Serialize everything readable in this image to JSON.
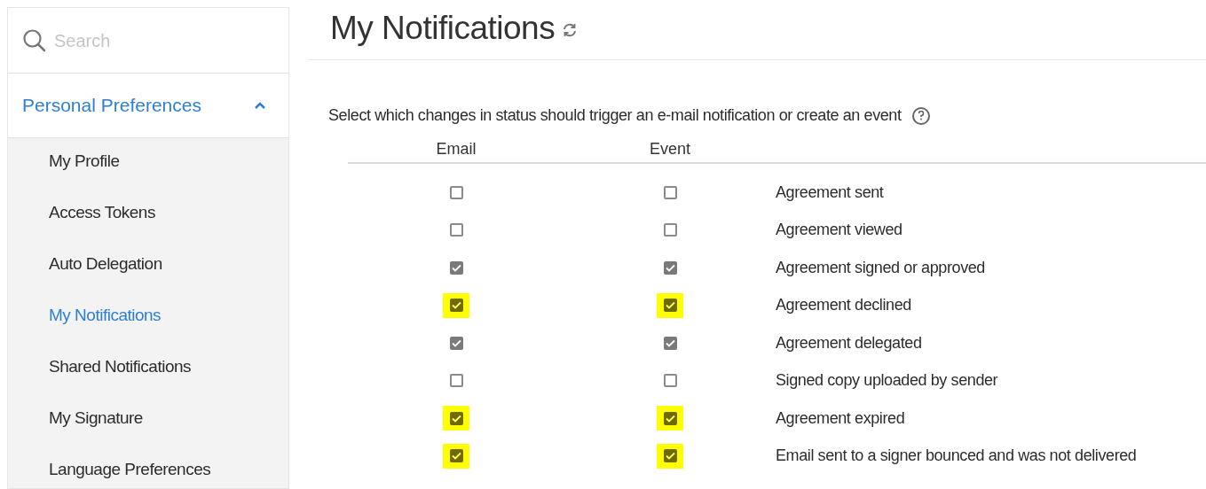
{
  "sidebar": {
    "search": {
      "placeholder": "Search"
    },
    "section": {
      "label": "Personal Preferences",
      "expanded": true
    },
    "items": [
      {
        "label": "My Profile",
        "selected": false
      },
      {
        "label": "Access Tokens",
        "selected": false
      },
      {
        "label": "Auto Delegation",
        "selected": false
      },
      {
        "label": "My Notifications",
        "selected": true
      },
      {
        "label": "Shared Notifications",
        "selected": false
      },
      {
        "label": "My Signature",
        "selected": false
      },
      {
        "label": "Language Preferences",
        "selected": false
      }
    ]
  },
  "page": {
    "title": "My Notifications",
    "instruction": "Select which changes in status should trigger an e-mail notification or create an event",
    "columns": [
      "Email",
      "Event"
    ],
    "rows": [
      {
        "label": "Agreement sent",
        "email": {
          "checked": false,
          "highlighted": false
        },
        "event": {
          "checked": false,
          "highlighted": false
        }
      },
      {
        "label": "Agreement viewed",
        "email": {
          "checked": false,
          "highlighted": false
        },
        "event": {
          "checked": false,
          "highlighted": false
        }
      },
      {
        "label": "Agreement signed or approved",
        "email": {
          "checked": true,
          "highlighted": false
        },
        "event": {
          "checked": true,
          "highlighted": false
        }
      },
      {
        "label": "Agreement declined",
        "email": {
          "checked": true,
          "highlighted": true
        },
        "event": {
          "checked": true,
          "highlighted": true
        }
      },
      {
        "label": "Agreement delegated",
        "email": {
          "checked": true,
          "highlighted": false
        },
        "event": {
          "checked": true,
          "highlighted": false
        }
      },
      {
        "label": "Signed copy uploaded by sender",
        "email": {
          "checked": false,
          "highlighted": false
        },
        "event": {
          "checked": false,
          "highlighted": false
        }
      },
      {
        "label": "Agreement expired",
        "email": {
          "checked": true,
          "highlighted": true
        },
        "event": {
          "checked": true,
          "highlighted": true
        }
      },
      {
        "label": "Email sent to a signer bounced and was not delivered",
        "email": {
          "checked": true,
          "highlighted": true
        },
        "event": {
          "checked": true,
          "highlighted": true
        }
      }
    ]
  }
}
